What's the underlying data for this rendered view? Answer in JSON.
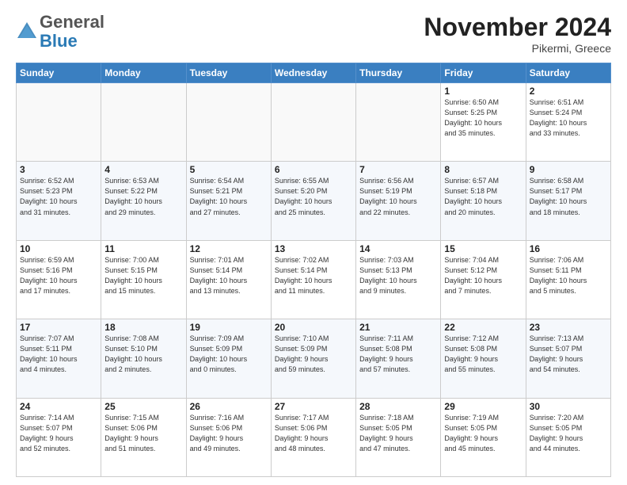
{
  "header": {
    "logo_general": "General",
    "logo_blue": "Blue",
    "title": "November 2024",
    "location": "Pikermi, Greece"
  },
  "days_of_week": [
    "Sunday",
    "Monday",
    "Tuesday",
    "Wednesday",
    "Thursday",
    "Friday",
    "Saturday"
  ],
  "weeks": [
    [
      {
        "day": "",
        "info": ""
      },
      {
        "day": "",
        "info": ""
      },
      {
        "day": "",
        "info": ""
      },
      {
        "day": "",
        "info": ""
      },
      {
        "day": "",
        "info": ""
      },
      {
        "day": "1",
        "info": "Sunrise: 6:50 AM\nSunset: 5:25 PM\nDaylight: 10 hours\nand 35 minutes."
      },
      {
        "day": "2",
        "info": "Sunrise: 6:51 AM\nSunset: 5:24 PM\nDaylight: 10 hours\nand 33 minutes."
      }
    ],
    [
      {
        "day": "3",
        "info": "Sunrise: 6:52 AM\nSunset: 5:23 PM\nDaylight: 10 hours\nand 31 minutes."
      },
      {
        "day": "4",
        "info": "Sunrise: 6:53 AM\nSunset: 5:22 PM\nDaylight: 10 hours\nand 29 minutes."
      },
      {
        "day": "5",
        "info": "Sunrise: 6:54 AM\nSunset: 5:21 PM\nDaylight: 10 hours\nand 27 minutes."
      },
      {
        "day": "6",
        "info": "Sunrise: 6:55 AM\nSunset: 5:20 PM\nDaylight: 10 hours\nand 25 minutes."
      },
      {
        "day": "7",
        "info": "Sunrise: 6:56 AM\nSunset: 5:19 PM\nDaylight: 10 hours\nand 22 minutes."
      },
      {
        "day": "8",
        "info": "Sunrise: 6:57 AM\nSunset: 5:18 PM\nDaylight: 10 hours\nand 20 minutes."
      },
      {
        "day": "9",
        "info": "Sunrise: 6:58 AM\nSunset: 5:17 PM\nDaylight: 10 hours\nand 18 minutes."
      }
    ],
    [
      {
        "day": "10",
        "info": "Sunrise: 6:59 AM\nSunset: 5:16 PM\nDaylight: 10 hours\nand 17 minutes."
      },
      {
        "day": "11",
        "info": "Sunrise: 7:00 AM\nSunset: 5:15 PM\nDaylight: 10 hours\nand 15 minutes."
      },
      {
        "day": "12",
        "info": "Sunrise: 7:01 AM\nSunset: 5:14 PM\nDaylight: 10 hours\nand 13 minutes."
      },
      {
        "day": "13",
        "info": "Sunrise: 7:02 AM\nSunset: 5:14 PM\nDaylight: 10 hours\nand 11 minutes."
      },
      {
        "day": "14",
        "info": "Sunrise: 7:03 AM\nSunset: 5:13 PM\nDaylight: 10 hours\nand 9 minutes."
      },
      {
        "day": "15",
        "info": "Sunrise: 7:04 AM\nSunset: 5:12 PM\nDaylight: 10 hours\nand 7 minutes."
      },
      {
        "day": "16",
        "info": "Sunrise: 7:06 AM\nSunset: 5:11 PM\nDaylight: 10 hours\nand 5 minutes."
      }
    ],
    [
      {
        "day": "17",
        "info": "Sunrise: 7:07 AM\nSunset: 5:11 PM\nDaylight: 10 hours\nand 4 minutes."
      },
      {
        "day": "18",
        "info": "Sunrise: 7:08 AM\nSunset: 5:10 PM\nDaylight: 10 hours\nand 2 minutes."
      },
      {
        "day": "19",
        "info": "Sunrise: 7:09 AM\nSunset: 5:09 PM\nDaylight: 10 hours\nand 0 minutes."
      },
      {
        "day": "20",
        "info": "Sunrise: 7:10 AM\nSunset: 5:09 PM\nDaylight: 9 hours\nand 59 minutes."
      },
      {
        "day": "21",
        "info": "Sunrise: 7:11 AM\nSunset: 5:08 PM\nDaylight: 9 hours\nand 57 minutes."
      },
      {
        "day": "22",
        "info": "Sunrise: 7:12 AM\nSunset: 5:08 PM\nDaylight: 9 hours\nand 55 minutes."
      },
      {
        "day": "23",
        "info": "Sunrise: 7:13 AM\nSunset: 5:07 PM\nDaylight: 9 hours\nand 54 minutes."
      }
    ],
    [
      {
        "day": "24",
        "info": "Sunrise: 7:14 AM\nSunset: 5:07 PM\nDaylight: 9 hours\nand 52 minutes."
      },
      {
        "day": "25",
        "info": "Sunrise: 7:15 AM\nSunset: 5:06 PM\nDaylight: 9 hours\nand 51 minutes."
      },
      {
        "day": "26",
        "info": "Sunrise: 7:16 AM\nSunset: 5:06 PM\nDaylight: 9 hours\nand 49 minutes."
      },
      {
        "day": "27",
        "info": "Sunrise: 7:17 AM\nSunset: 5:06 PM\nDaylight: 9 hours\nand 48 minutes."
      },
      {
        "day": "28",
        "info": "Sunrise: 7:18 AM\nSunset: 5:05 PM\nDaylight: 9 hours\nand 47 minutes."
      },
      {
        "day": "29",
        "info": "Sunrise: 7:19 AM\nSunset: 5:05 PM\nDaylight: 9 hours\nand 45 minutes."
      },
      {
        "day": "30",
        "info": "Sunrise: 7:20 AM\nSunset: 5:05 PM\nDaylight: 9 hours\nand 44 minutes."
      }
    ]
  ]
}
